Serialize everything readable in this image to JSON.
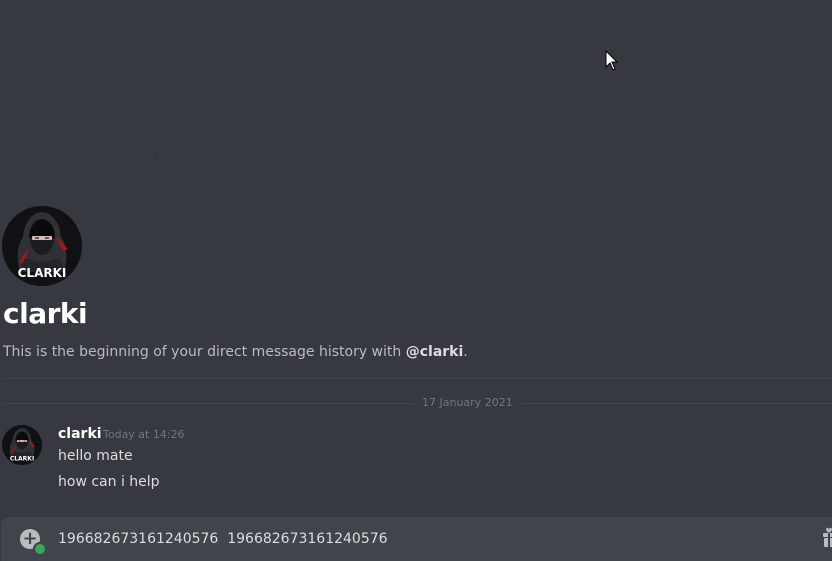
{
  "dm": {
    "avatar_text": "CLARKI",
    "username": "clarki",
    "intro_prefix": "This is the beginning of your direct message history with ",
    "intro_mention": "@clarki",
    "intro_suffix": "."
  },
  "date_divider": {
    "label": "17 January 2021"
  },
  "message_group": {
    "author": "clarki",
    "timestamp": "Today at 14:26",
    "avatar_text": "CLARKI",
    "messages": [
      "hello mate",
      "how can i help"
    ]
  },
  "composer": {
    "text": "196682673161240576  196682673161240576",
    "attach_icon": "add-circle-icon",
    "upload_badge_icon": "upload-badge-icon",
    "gift_icon": "gift-icon"
  },
  "colors": {
    "background": "#36393f",
    "composer_background": "#40444b",
    "username": "#ffffff",
    "text": "#dcddde",
    "muted": "#72767d",
    "online_green": "#3ba55c"
  }
}
